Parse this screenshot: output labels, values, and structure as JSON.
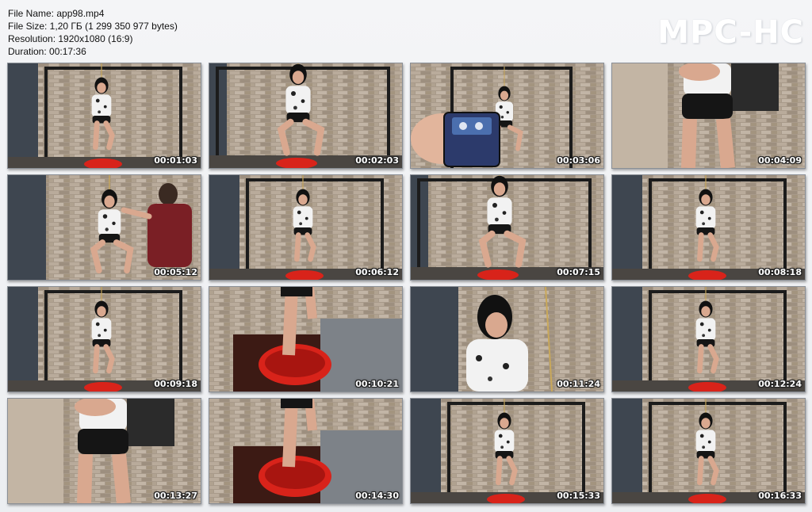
{
  "info": {
    "file_name": "File Name: app98.mp4",
    "file_size": "File Size: 1,20 ГБ (1 299 350 977 bytes)",
    "resolution": "Resolution: 1920x1080 (16:9)",
    "duration": "Duration: 00:17:36"
  },
  "brand": "MPC-HC",
  "thumbnails": [
    {
      "time": "00:01:03",
      "scene": "wide"
    },
    {
      "time": "00:02:03",
      "scene": "seated"
    },
    {
      "time": "00:03:06",
      "scene": "phone"
    },
    {
      "time": "00:04:09",
      "scene": "close-body"
    },
    {
      "time": "00:05:12",
      "scene": "two-people"
    },
    {
      "time": "00:06:12",
      "scene": "wide"
    },
    {
      "time": "00:07:15",
      "scene": "seated"
    },
    {
      "time": "00:08:18",
      "scene": "wide"
    },
    {
      "time": "00:09:18",
      "scene": "wide"
    },
    {
      "time": "00:10:21",
      "scene": "basin"
    },
    {
      "time": "00:11:24",
      "scene": "close-torso"
    },
    {
      "time": "00:12:24",
      "scene": "wide"
    },
    {
      "time": "00:13:27",
      "scene": "close-body"
    },
    {
      "time": "00:14:30",
      "scene": "basin"
    },
    {
      "time": "00:15:33",
      "scene": "wide"
    },
    {
      "time": "00:16:33",
      "scene": "wide"
    }
  ],
  "colors": {
    "wall": "#a89a8a",
    "curtain": "#3e4650",
    "frame": "#1c1c1c",
    "basin": "#d8231a",
    "shirt": "#f2f2f2",
    "skin": "#d9a88f",
    "shorts": "#151515",
    "hair": "#111111"
  }
}
